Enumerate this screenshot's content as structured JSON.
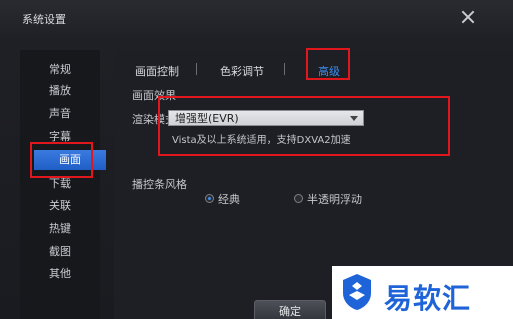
{
  "window": {
    "title": "系统设置"
  },
  "sidebar": {
    "items": [
      {
        "label": "常规"
      },
      {
        "label": "播放"
      },
      {
        "label": "声音"
      },
      {
        "label": "字幕"
      },
      {
        "label": "画面"
      },
      {
        "label": "下载"
      },
      {
        "label": "关联"
      },
      {
        "label": "热键"
      },
      {
        "label": "截图"
      },
      {
        "label": "其他"
      }
    ],
    "active": "画面"
  },
  "tabs": [
    {
      "label": "画面控制"
    },
    {
      "label": "色彩调节"
    },
    {
      "label": "高级"
    }
  ],
  "active_tab": "高级",
  "effects": {
    "section_title": "画面效果",
    "render_label": "渲染模式",
    "render_value": "增强型(EVR)",
    "render_hint": "Vista及以上系统适用，支持DXVA2加速"
  },
  "control_bar": {
    "section_title": "播控条风格",
    "options": [
      {
        "label": "经典",
        "selected": true
      },
      {
        "label": "半透明浮动",
        "selected": false
      }
    ]
  },
  "buttons": {
    "ok": "确定"
  },
  "watermark": {
    "text": "易软汇"
  },
  "colors": {
    "accent": "#3d8ef0",
    "highlight_box": "#e0171d"
  }
}
